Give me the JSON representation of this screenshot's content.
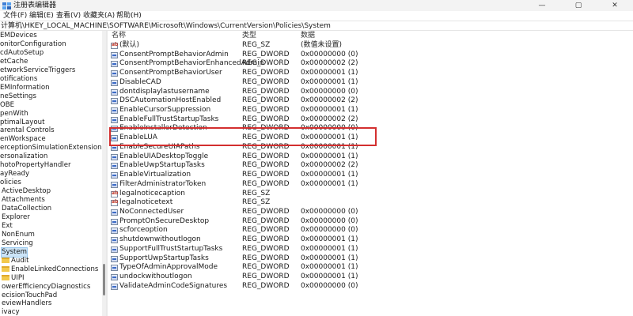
{
  "window": {
    "title": "注册表编辑器",
    "minimize": "—",
    "maximize": "▢",
    "close": "✕"
  },
  "menu": [
    "文件(F)",
    "编辑(E)",
    "查看(V)",
    "收藏夹(A)",
    "帮助(H)"
  ],
  "address": "计算机\\HKEY_LOCAL_MACHINE\\SOFTWARE\\Microsoft\\Windows\\CurrentVersion\\Policies\\System",
  "tree": [
    {
      "label": "EMDevices",
      "folder": false
    },
    {
      "label": "onitorConfiguration",
      "folder": false
    },
    {
      "label": "cdAutoSetup",
      "folder": false
    },
    {
      "label": "etCache",
      "folder": false
    },
    {
      "label": "etworkServiceTriggers",
      "folder": false
    },
    {
      "label": "otifications",
      "folder": false
    },
    {
      "label": "EMInformation",
      "folder": false
    },
    {
      "label": "neSettings",
      "folder": false
    },
    {
      "label": "OBE",
      "folder": false
    },
    {
      "label": "penWith",
      "folder": false
    },
    {
      "label": "ptimalLayout",
      "folder": false
    },
    {
      "label": "arental Controls",
      "folder": false
    },
    {
      "label": "enWorkspace",
      "folder": false
    },
    {
      "label": "erceptionSimulationExtensions",
      "folder": false
    },
    {
      "label": "ersonalization",
      "folder": false
    },
    {
      "label": "hotoPropertyHandler",
      "folder": false
    },
    {
      "label": "ayReady",
      "folder": false
    },
    {
      "label": "olicies",
      "folder": false
    },
    {
      "label": "ActiveDesktop",
      "folder": false
    },
    {
      "label": "Attachments",
      "folder": false
    },
    {
      "label": "DataCollection",
      "folder": false
    },
    {
      "label": "Explorer",
      "folder": false
    },
    {
      "label": "Ext",
      "folder": false
    },
    {
      "label": "NonEnum",
      "folder": false
    },
    {
      "label": "Servicing",
      "folder": false
    },
    {
      "label": "System",
      "folder": false,
      "selected": true
    },
    {
      "label": "Audit",
      "folder": true
    },
    {
      "label": "EnableLinkedConnections",
      "folder": true
    },
    {
      "label": "UIPI",
      "folder": true
    },
    {
      "label": "owerEfficiencyDiagnostics",
      "folder": false
    },
    {
      "label": "ecisionTouchPad",
      "folder": false
    },
    {
      "label": "eviewHandlers",
      "folder": false
    },
    {
      "label": "ivacy",
      "folder": false
    }
  ],
  "columns": {
    "name": "名称",
    "type": "类型",
    "data": "数据"
  },
  "values": [
    {
      "name": "(默认)",
      "type": "REG_SZ",
      "data": "(数值未设置)",
      "icon": "sz"
    },
    {
      "name": "ConsentPromptBehaviorAdmin",
      "type": "REG_DWORD",
      "data": "0x00000000 (0)",
      "icon": "dword"
    },
    {
      "name": "ConsentPromptBehaviorEnhancedAdmin",
      "type": "REG_DWORD",
      "data": "0x00000002 (2)",
      "icon": "dword"
    },
    {
      "name": "ConsentPromptBehaviorUser",
      "type": "REG_DWORD",
      "data": "0x00000001 (1)",
      "icon": "dword"
    },
    {
      "name": "DisableCAD",
      "type": "REG_DWORD",
      "data": "0x00000001 (1)",
      "icon": "dword"
    },
    {
      "name": "dontdisplaylastusername",
      "type": "REG_DWORD",
      "data": "0x00000000 (0)",
      "icon": "dword"
    },
    {
      "name": "DSCAutomationHostEnabled",
      "type": "REG_DWORD",
      "data": "0x00000002 (2)",
      "icon": "dword"
    },
    {
      "name": "EnableCursorSuppression",
      "type": "REG_DWORD",
      "data": "0x00000001 (1)",
      "icon": "dword"
    },
    {
      "name": "EnableFullTrustStartupTasks",
      "type": "REG_DWORD",
      "data": "0x00000002 (2)",
      "icon": "dword"
    },
    {
      "name": "EnableInstallerDetection",
      "type": "REG_DWORD",
      "data": "0x00000000 (0)",
      "icon": "dword"
    },
    {
      "name": "EnableLUA",
      "type": "REG_DWORD",
      "data": "0x00000001 (1)",
      "icon": "dword"
    },
    {
      "name": "EnableSecureUIAPaths",
      "type": "REG_DWORD",
      "data": "0x00000001 (1)",
      "icon": "dword"
    },
    {
      "name": "EnableUIADesktopToggle",
      "type": "REG_DWORD",
      "data": "0x00000001 (1)",
      "icon": "dword"
    },
    {
      "name": "EnableUwpStartupTasks",
      "type": "REG_DWORD",
      "data": "0x00000002 (2)",
      "icon": "dword"
    },
    {
      "name": "EnableVirtualization",
      "type": "REG_DWORD",
      "data": "0x00000001 (1)",
      "icon": "dword"
    },
    {
      "name": "FilterAdministratorToken",
      "type": "REG_DWORD",
      "data": "0x00000001 (1)",
      "icon": "dword"
    },
    {
      "name": "legalnoticecaption",
      "type": "REG_SZ",
      "data": "",
      "icon": "sz"
    },
    {
      "name": "legalnoticetext",
      "type": "REG_SZ",
      "data": "",
      "icon": "sz"
    },
    {
      "name": "NoConnectedUser",
      "type": "REG_DWORD",
      "data": "0x00000000 (0)",
      "icon": "dword"
    },
    {
      "name": "PromptOnSecureDesktop",
      "type": "REG_DWORD",
      "data": "0x00000000 (0)",
      "icon": "dword"
    },
    {
      "name": "scforceoption",
      "type": "REG_DWORD",
      "data": "0x00000000 (0)",
      "icon": "dword"
    },
    {
      "name": "shutdownwithoutlogon",
      "type": "REG_DWORD",
      "data": "0x00000001 (1)",
      "icon": "dword"
    },
    {
      "name": "SupportFullTrustStartupTasks",
      "type": "REG_DWORD",
      "data": "0x00000001 (1)",
      "icon": "dword"
    },
    {
      "name": "SupportUwpStartupTasks",
      "type": "REG_DWORD",
      "data": "0x00000001 (1)",
      "icon": "dword"
    },
    {
      "name": "TypeOfAdminApprovalMode",
      "type": "REG_DWORD",
      "data": "0x00000001 (1)",
      "icon": "dword"
    },
    {
      "name": "undockwithoutlogon",
      "type": "REG_DWORD",
      "data": "0x00000001 (1)",
      "icon": "dword"
    },
    {
      "name": "ValidateAdminCodeSignatures",
      "type": "REG_DWORD",
      "data": "0x00000000 (0)",
      "icon": "dword"
    }
  ],
  "highlighted_value": "EnableLUA",
  "colors": {
    "highlight_border": "#d32f2f",
    "selection": "#cce4f7"
  }
}
